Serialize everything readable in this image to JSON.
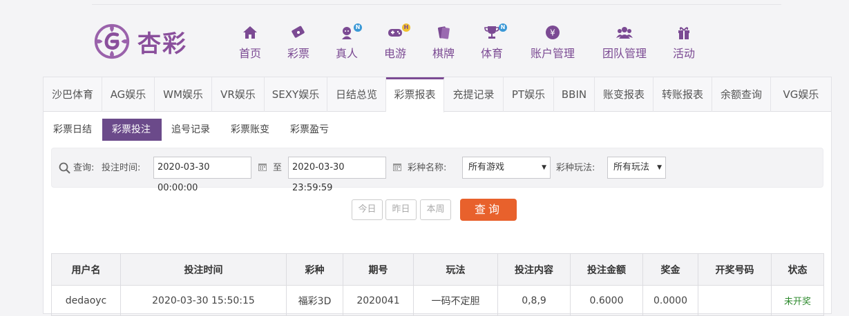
{
  "brand": {
    "logo_text": "杏彩",
    "accent": "#7b4a93"
  },
  "nav": [
    {
      "label": "首页",
      "icon": "home-icon",
      "badge": ""
    },
    {
      "label": "彩票",
      "icon": "ticket-icon",
      "badge": ""
    },
    {
      "label": "真人",
      "icon": "dealer-icon",
      "badge": "N"
    },
    {
      "label": "电游",
      "icon": "gamepad-icon",
      "badge": "H"
    },
    {
      "label": "棋牌",
      "icon": "cards-icon",
      "badge": ""
    },
    {
      "label": "体育",
      "icon": "trophy-icon",
      "badge": "N"
    },
    {
      "label": "账户管理",
      "icon": "yen-icon",
      "badge": ""
    },
    {
      "label": "团队管理",
      "icon": "team-icon",
      "badge": ""
    },
    {
      "label": "活动",
      "icon": "gift-icon",
      "badge": ""
    }
  ],
  "tabs": [
    "沙巴体育",
    "AG娱乐",
    "WM娱乐",
    "VR娱乐",
    "SEXY娱乐",
    "日结总览",
    "彩票报表",
    "充提记录",
    "PT娱乐",
    "BBIN",
    "账变报表",
    "转账报表",
    "余额查询",
    "VG娱乐"
  ],
  "active_tab": "彩票报表",
  "subtabs": [
    "彩票日结",
    "彩票投注",
    "追号记录",
    "彩票账变",
    "彩票盈亏"
  ],
  "active_subtab": "彩票投注",
  "filter": {
    "query_label": "查询:",
    "time_label": "投注时间:",
    "start_time": "2020-03-30 00:00:00",
    "to_label": "至",
    "end_time": "2020-03-30 23:59:59",
    "game_label": "彩种名称:",
    "game_value": "所有游戏",
    "play_label": "彩种玩法:",
    "play_value": "所有玩法"
  },
  "quick_buttons": [
    "今日",
    "昨日",
    "本周"
  ],
  "search_button": "查询",
  "table": {
    "headers": [
      "用户名",
      "投注时间",
      "彩种",
      "期号",
      "玩法",
      "投注内容",
      "投注金额",
      "奖金",
      "开奖号码",
      "状态"
    ],
    "rows": [
      [
        "dedaoyc",
        "2020-03-30 15:50:15",
        "福彩3D",
        "2020041",
        "一码不定胆",
        "0,8,9",
        "0.6000",
        "0.0000",
        "",
        "未开奖"
      ]
    ]
  }
}
